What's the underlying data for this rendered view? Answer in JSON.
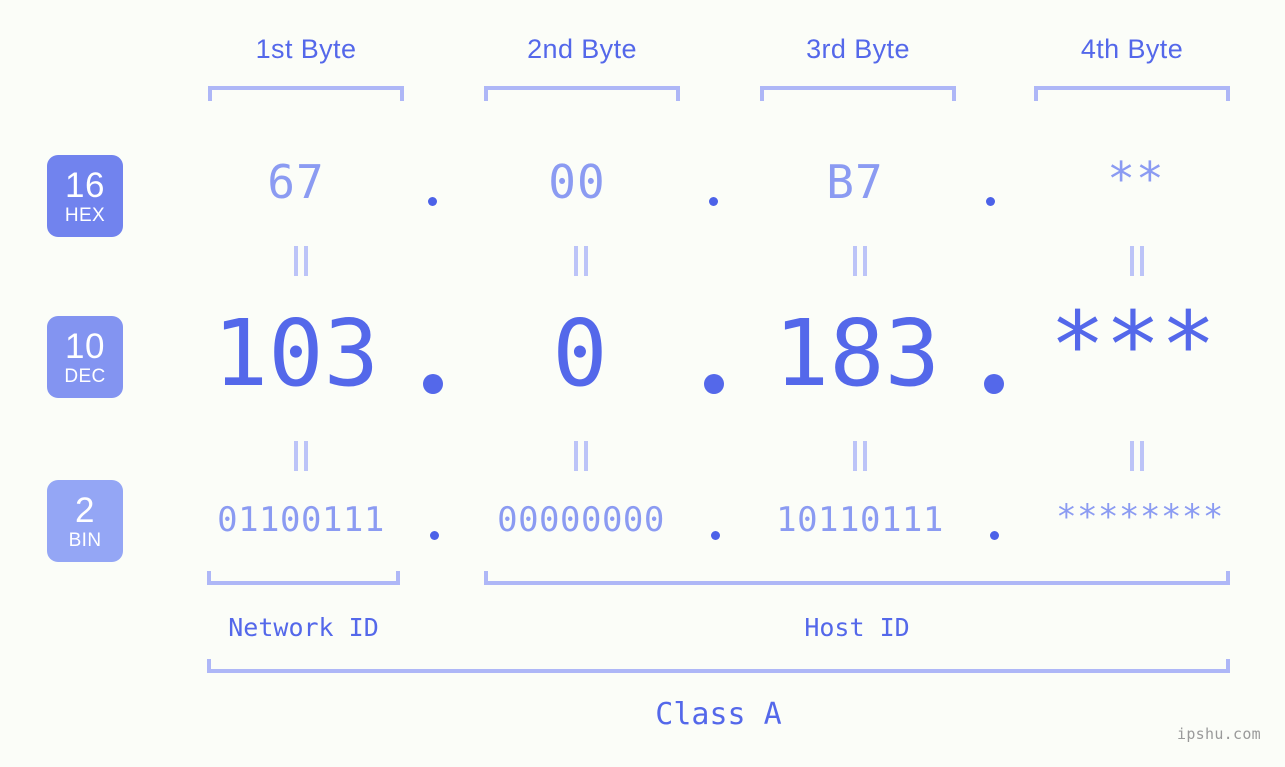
{
  "background_color": "#fbfdf8",
  "accent_color": "#5468ea",
  "muted_accent_color": "#8b9bf2",
  "bracket_color": "#aeb7f7",
  "byte_headers": [
    {
      "label": "1st Byte"
    },
    {
      "label": "2nd Byte"
    },
    {
      "label": "3rd Byte"
    },
    {
      "label": "4th Byte"
    }
  ],
  "radix_badges": [
    {
      "number": "16",
      "name": "HEX",
      "color": "#7183ee"
    },
    {
      "number": "10",
      "name": "DEC",
      "color": "#8394f1"
    },
    {
      "number": "2",
      "name": "BIN",
      "color": "#94a6f5"
    }
  ],
  "rows": {
    "hex": {
      "radix": "16",
      "name": "HEX",
      "values": [
        "67",
        "00",
        "B7",
        "**"
      ]
    },
    "dec": {
      "radix": "10",
      "name": "DEC",
      "values": [
        "103",
        "0",
        "183",
        "***"
      ]
    },
    "bin": {
      "radix": "2",
      "name": "BIN",
      "values": [
        "01100111",
        "00000000",
        "10110111",
        "********"
      ]
    }
  },
  "separator": ".",
  "equals_mark": "=",
  "id_labels": [
    {
      "label": "Network ID"
    },
    {
      "label": "Host ID"
    }
  ],
  "class_label": "Class A",
  "watermark": "ipshu.com"
}
